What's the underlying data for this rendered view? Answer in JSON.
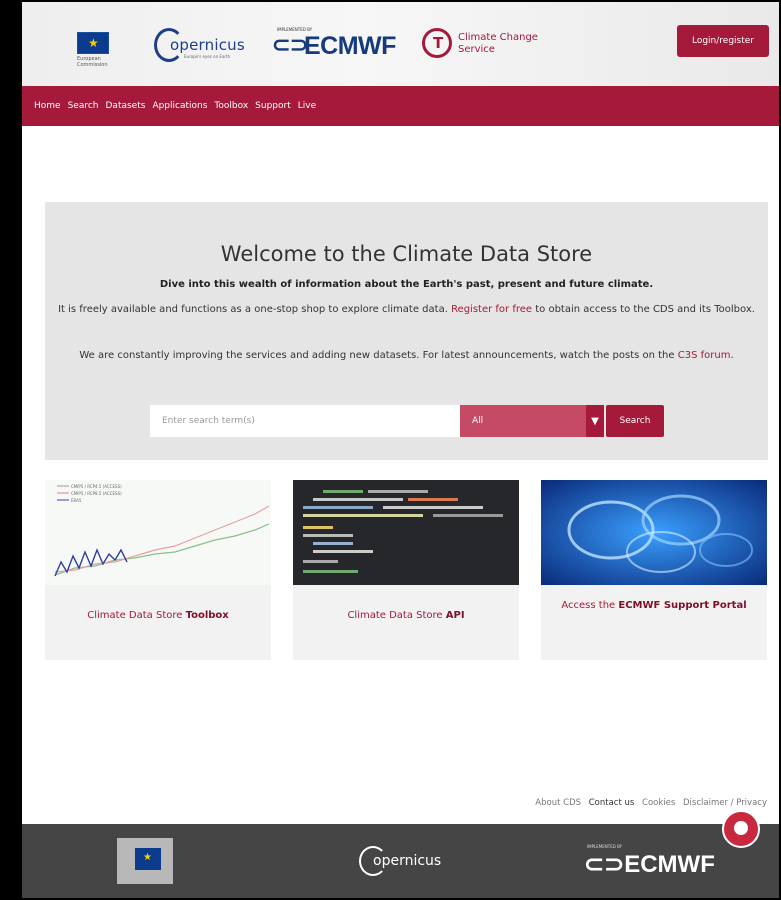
{
  "header": {
    "eu_caption": "European Commission",
    "copernicus_logo": "opernicus",
    "copernicus_tagline": "Europe's eyes on Earth",
    "ecmwf_implemented_by": "IMPLEMENTED BY",
    "ecmwf_logo": "ECMWF",
    "c3s_logo": "Climate Change Service",
    "login_label": "Login/register"
  },
  "nav": {
    "items": [
      {
        "label": "Home"
      },
      {
        "label": "Search"
      },
      {
        "label": "Datasets"
      },
      {
        "label": "Applications"
      },
      {
        "label": "Toolbox"
      },
      {
        "label": "Support"
      },
      {
        "label": "Live"
      }
    ]
  },
  "welcome": {
    "title": "Welcome to the Climate Data Store",
    "subtitle": "Dive into this wealth of information about the Earth's past, present and future climate.",
    "p1_before": "It is freely available and functions as a one-stop shop to explore climate data. ",
    "p1_link": "Register for free",
    "p1_after": " to obtain access to the CDS and its Toolbox.",
    "p2_before": "We are constantly improving the services and adding new datasets. For latest announcements, watch the posts on the ",
    "p2_link": "C3S forum",
    "p2_after": "."
  },
  "search": {
    "placeholder": "Enter search term(s)",
    "select_value": "All",
    "button_label": "Search"
  },
  "cards": [
    {
      "label_plain": "Climate Data Store ",
      "label_bold": "Toolbox",
      "legend": [
        "CMIP5 / RCP4.5 (ACCESS)",
        "CMIP5 / RCP8.5 (ACCESS)",
        "ERA5"
      ]
    },
    {
      "label_plain": "Climate Data Store ",
      "label_bold": "API"
    },
    {
      "label_plain": "Access the ",
      "label_bold": "ECMWF Support Portal"
    }
  ],
  "footer": {
    "links": [
      {
        "label": "About CDS"
      },
      {
        "label": "Contact us"
      },
      {
        "label": "Cookies"
      },
      {
        "label": "Disclaimer / Privacy"
      }
    ],
    "copernicus_logo": "opernicus",
    "ecmwf_implemented_by": "IMPLEMENTED BY",
    "ecmwf_logo": "ECMWF"
  },
  "colors": {
    "brand": "#a5193a",
    "header_bg": "#eeeeee",
    "welcome_bg": "#e5e5e5",
    "footer_bg": "#454545"
  },
  "icons": [
    "eu-flag-icon",
    "copernicus-logo-icon",
    "ecmwf-logo-icon",
    "c3s-logo-icon",
    "chevron-down-icon",
    "mascot-icon"
  ]
}
